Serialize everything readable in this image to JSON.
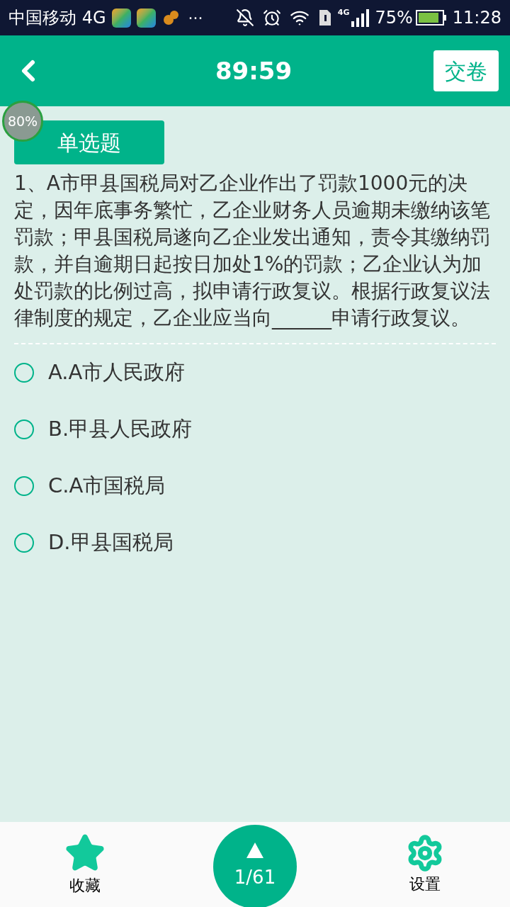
{
  "status_bar": {
    "carrier": "中国移动 4G",
    "more": "···",
    "network": "4G",
    "battery": "75%",
    "time": "11:28"
  },
  "header": {
    "timer": "89:59",
    "submit": "交卷"
  },
  "floating_badge": "80%",
  "question": {
    "type": "单选题",
    "text": "1、A市甲县国税局对乙企业作出了罚款1000元的决定，因年底事务繁忙，乙企业财务人员逾期未缴纳该笔罚款；甲县国税局遂向乙企业发出通知，责令其缴纳罚款，并自逾期日起按日加处1%的罚款；乙企业认为加处罚款的比例过高，拟申请行政复议。根据行政复议法律制度的规定，乙企业应当向______申请行政复议。"
  },
  "options": [
    {
      "label": "A.A市人民政府",
      "selected": false
    },
    {
      "label": "B.甲县人民政府",
      "selected": false
    },
    {
      "label": "C.A市国税局",
      "selected": false
    },
    {
      "label": "D.甲县国税局",
      "selected": false
    }
  ],
  "bottom_bar": {
    "favorite": "收藏",
    "progress": "1/61",
    "settings": "设置"
  }
}
